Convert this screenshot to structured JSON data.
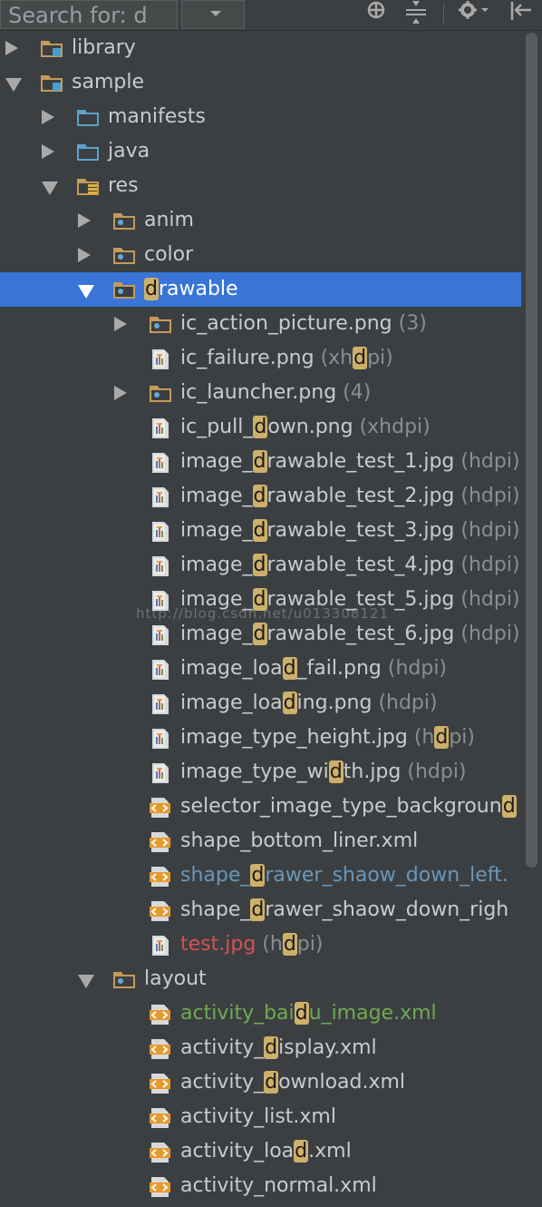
{
  "search": {
    "text": "Search for: d"
  },
  "watermark": "http://blog.csdn.net/u013308121",
  "tree": [
    {
      "indent": 0,
      "arrow": "collapsed",
      "icon": "folder-module",
      "parts": [
        {
          "t": "library"
        }
      ]
    },
    {
      "indent": 0,
      "arrow": "expanded",
      "icon": "folder-module",
      "parts": [
        {
          "t": "sample"
        }
      ]
    },
    {
      "indent": 1,
      "arrow": "collapsed",
      "icon": "folder-blue",
      "parts": [
        {
          "t": "manifests"
        }
      ]
    },
    {
      "indent": 1,
      "arrow": "collapsed",
      "icon": "folder-blue",
      "parts": [
        {
          "t": "java"
        }
      ]
    },
    {
      "indent": 1,
      "arrow": "expanded",
      "icon": "folder-res",
      "parts": [
        {
          "t": "res"
        }
      ]
    },
    {
      "indent": 2,
      "arrow": "collapsed",
      "icon": "folder-dot",
      "parts": [
        {
          "t": "anim"
        }
      ]
    },
    {
      "indent": 2,
      "arrow": "collapsed",
      "icon": "folder-dot",
      "parts": [
        {
          "t": "color"
        }
      ]
    },
    {
      "indent": 2,
      "arrow": "expanded",
      "icon": "folder-dot",
      "selected": true,
      "parts": [
        {
          "t": "d",
          "h": true
        },
        {
          "t": "rawable"
        }
      ]
    },
    {
      "indent": 3,
      "arrow": "collapsed",
      "icon": "folder-dot",
      "parts": [
        {
          "t": "ic_action_picture.png "
        },
        {
          "t": "(3)",
          "s": true
        }
      ]
    },
    {
      "indent": 3,
      "arrow": "none",
      "icon": "image-file",
      "parts": [
        {
          "t": "ic_failure.png "
        },
        {
          "t": "(xh",
          "s": true
        },
        {
          "t": "d",
          "h": true
        },
        {
          "t": "pi)",
          "s": true
        }
      ]
    },
    {
      "indent": 3,
      "arrow": "collapsed",
      "icon": "folder-dot",
      "parts": [
        {
          "t": "ic_launcher.png "
        },
        {
          "t": "(4)",
          "s": true
        }
      ]
    },
    {
      "indent": 3,
      "arrow": "none",
      "icon": "image-file",
      "parts": [
        {
          "t": "ic_pull_"
        },
        {
          "t": "d",
          "h": true
        },
        {
          "t": "own.png "
        },
        {
          "t": "(xhdpi)",
          "s": true
        }
      ]
    },
    {
      "indent": 3,
      "arrow": "none",
      "icon": "image-file",
      "parts": [
        {
          "t": "image_"
        },
        {
          "t": "d",
          "h": true
        },
        {
          "t": "rawable_test_1.jpg "
        },
        {
          "t": "(hdpi)",
          "s": true
        }
      ]
    },
    {
      "indent": 3,
      "arrow": "none",
      "icon": "image-file",
      "parts": [
        {
          "t": "image_"
        },
        {
          "t": "d",
          "h": true
        },
        {
          "t": "rawable_test_2.jpg "
        },
        {
          "t": "(hdpi)",
          "s": true
        }
      ]
    },
    {
      "indent": 3,
      "arrow": "none",
      "icon": "image-file",
      "parts": [
        {
          "t": "image_"
        },
        {
          "t": "d",
          "h": true
        },
        {
          "t": "rawable_test_3.jpg "
        },
        {
          "t": "(hdpi)",
          "s": true
        }
      ]
    },
    {
      "indent": 3,
      "arrow": "none",
      "icon": "image-file",
      "parts": [
        {
          "t": "image_"
        },
        {
          "t": "d",
          "h": true
        },
        {
          "t": "rawable_test_4.jpg "
        },
        {
          "t": "(hdpi)",
          "s": true
        }
      ]
    },
    {
      "indent": 3,
      "arrow": "none",
      "icon": "image-file",
      "parts": [
        {
          "t": "image_"
        },
        {
          "t": "d",
          "h": true
        },
        {
          "t": "rawable_test_5.jpg "
        },
        {
          "t": "(hdpi)",
          "s": true
        }
      ]
    },
    {
      "indent": 3,
      "arrow": "none",
      "icon": "image-file",
      "parts": [
        {
          "t": "image_"
        },
        {
          "t": "d",
          "h": true
        },
        {
          "t": "rawable_test_6.jpg "
        },
        {
          "t": "(hdpi)",
          "s": true
        }
      ]
    },
    {
      "indent": 3,
      "arrow": "none",
      "icon": "image-file",
      "parts": [
        {
          "t": "image_loa"
        },
        {
          "t": "d",
          "h": true
        },
        {
          "t": "_fail.png "
        },
        {
          "t": "(hdpi)",
          "s": true
        }
      ]
    },
    {
      "indent": 3,
      "arrow": "none",
      "icon": "image-file",
      "parts": [
        {
          "t": "image_loa"
        },
        {
          "t": "d",
          "h": true
        },
        {
          "t": "ing.png "
        },
        {
          "t": "(hdpi)",
          "s": true
        }
      ]
    },
    {
      "indent": 3,
      "arrow": "none",
      "icon": "image-file",
      "parts": [
        {
          "t": "image_type_height.jpg "
        },
        {
          "t": "(h",
          "s": true
        },
        {
          "t": "d",
          "h": true
        },
        {
          "t": "pi)",
          "s": true
        }
      ]
    },
    {
      "indent": 3,
      "arrow": "none",
      "icon": "image-file",
      "parts": [
        {
          "t": "image_type_wi"
        },
        {
          "t": "d",
          "h": true
        },
        {
          "t": "th.jpg "
        },
        {
          "t": "(hdpi)",
          "s": true
        }
      ]
    },
    {
      "indent": 3,
      "arrow": "none",
      "icon": "xml-file",
      "parts": [
        {
          "t": "selector_image_type_backgroun"
        },
        {
          "t": "d",
          "h": true
        }
      ]
    },
    {
      "indent": 3,
      "arrow": "none",
      "icon": "xml-file",
      "parts": [
        {
          "t": "shape_bottom_liner.xml"
        }
      ]
    },
    {
      "indent": 3,
      "arrow": "none",
      "icon": "xml-file",
      "color": "blue",
      "parts": [
        {
          "t": "shape_"
        },
        {
          "t": "d",
          "h": true
        },
        {
          "t": "rawer_shaow_down_left."
        }
      ]
    },
    {
      "indent": 3,
      "arrow": "none",
      "icon": "xml-file",
      "parts": [
        {
          "t": "shape_"
        },
        {
          "t": "d",
          "h": true
        },
        {
          "t": "rawer_shaow_down_righ"
        }
      ]
    },
    {
      "indent": 3,
      "arrow": "none",
      "icon": "image-file",
      "color": "red",
      "parts": [
        {
          "t": "test.jpg "
        },
        {
          "t": "(h",
          "s": true
        },
        {
          "t": "d",
          "h": true
        },
        {
          "t": "pi)",
          "s": true
        }
      ]
    },
    {
      "indent": 2,
      "arrow": "expanded",
      "icon": "folder-dot",
      "parts": [
        {
          "t": "layout"
        }
      ]
    },
    {
      "indent": 3,
      "arrow": "none",
      "icon": "xml-file",
      "color": "green",
      "parts": [
        {
          "t": "activity_bai"
        },
        {
          "t": "d",
          "h": true
        },
        {
          "t": "u_image.xml"
        }
      ]
    },
    {
      "indent": 3,
      "arrow": "none",
      "icon": "xml-file",
      "parts": [
        {
          "t": "activity_"
        },
        {
          "t": "d",
          "h": true
        },
        {
          "t": "isplay.xml"
        }
      ]
    },
    {
      "indent": 3,
      "arrow": "none",
      "icon": "xml-file",
      "parts": [
        {
          "t": "activity_"
        },
        {
          "t": "d",
          "h": true
        },
        {
          "t": "ownload.xml"
        }
      ]
    },
    {
      "indent": 3,
      "arrow": "none",
      "icon": "xml-file",
      "parts": [
        {
          "t": "activity_list.xml"
        }
      ]
    },
    {
      "indent": 3,
      "arrow": "none",
      "icon": "xml-file",
      "parts": [
        {
          "t": "activity_loa"
        },
        {
          "t": "d",
          "h": true
        },
        {
          "t": ".xml"
        }
      ]
    },
    {
      "indent": 3,
      "arrow": "none",
      "icon": "xml-file",
      "parts": [
        {
          "t": "activity_normal.xml"
        }
      ]
    }
  ]
}
